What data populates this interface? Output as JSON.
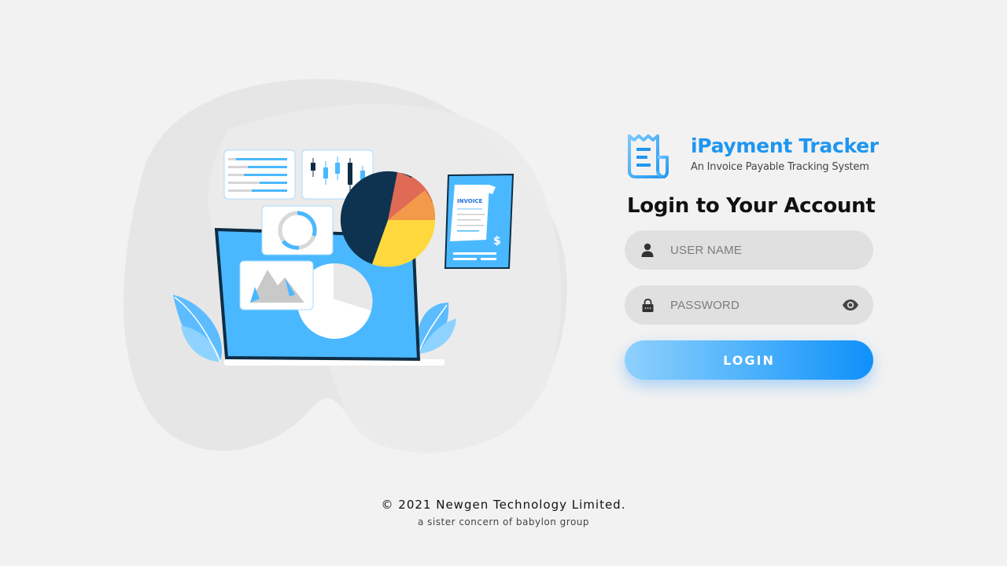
{
  "brand": {
    "title": "iPayment Tracker",
    "subtitle": "An Invoice Payable Tracking System",
    "logo_icon": "receipt-icon",
    "accent_color": "#1e96f0"
  },
  "login": {
    "heading": "Login to Your Account",
    "username": {
      "placeholder": "USER NAME",
      "value": "",
      "icon": "user-icon"
    },
    "password": {
      "placeholder": "PASSWORD",
      "value": "",
      "icon": "lock-icon",
      "toggle_icon": "eye-icon"
    },
    "button_label": "LOGIN"
  },
  "illustration": {
    "invoice_label": "INVOICE",
    "currency_symbol": "$"
  },
  "footer": {
    "copyright": "© 2021 Newgen Technology Limited.",
    "tagline": "a sister concern of babylon group"
  }
}
